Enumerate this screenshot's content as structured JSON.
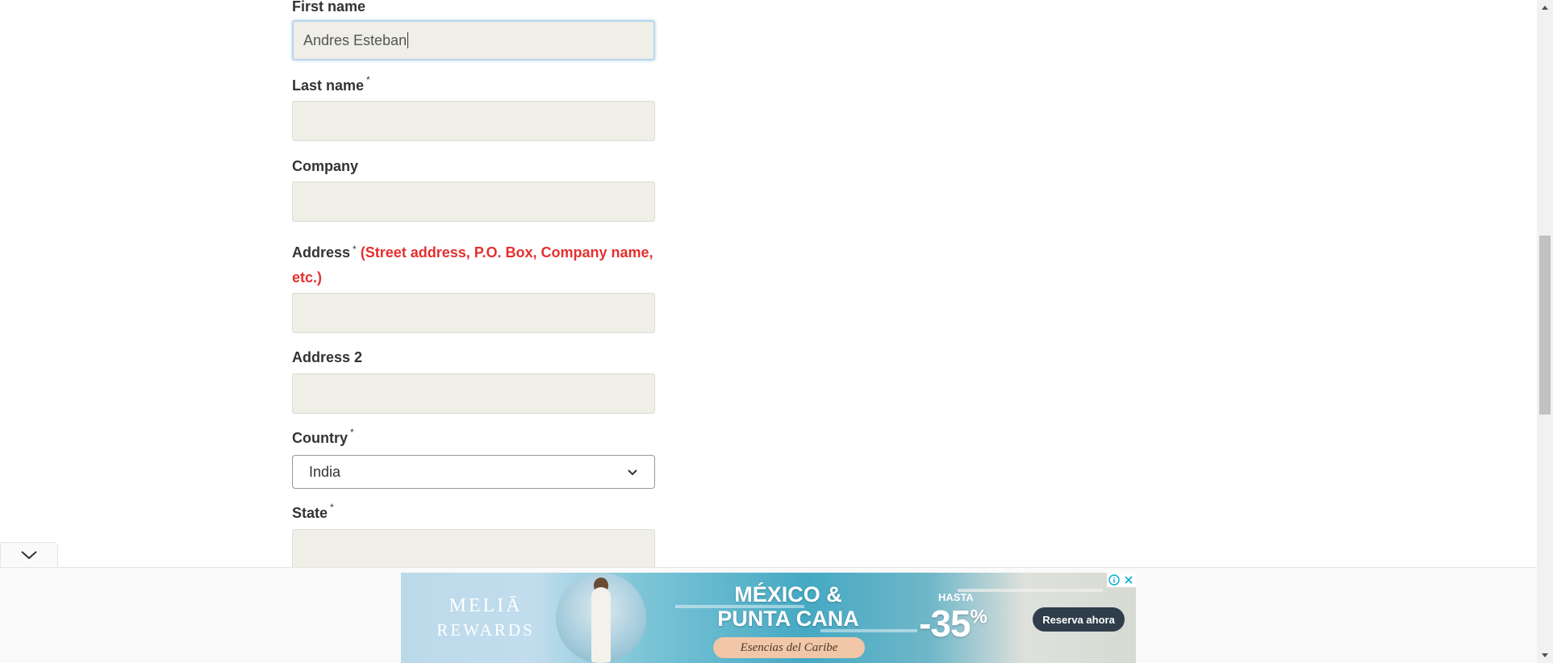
{
  "form": {
    "first_name": {
      "label": "First name",
      "value": "Andres Esteban"
    },
    "last_name": {
      "label": "Last name",
      "required_mark": "*",
      "value": ""
    },
    "company": {
      "label": "Company",
      "value": ""
    },
    "address": {
      "label": "Address",
      "required_mark": "*",
      "hint_line1": "(Street address, P.O. Box, Company name,",
      "hint_line2": "etc.)",
      "value": ""
    },
    "address2": {
      "label": "Address 2",
      "value": ""
    },
    "country": {
      "label": "Country",
      "required_mark": "*",
      "selected": "India"
    },
    "state": {
      "label": "State",
      "required_mark": "*",
      "value": ""
    }
  },
  "ad": {
    "brand_line1": "MELIĀ",
    "brand_line2": "REWARDS",
    "title_line1": "MÉXICO &",
    "title_line2": "PUNTA CANA",
    "tagline": "Esencias del Caribe",
    "hasta": "HASTA",
    "discount": "-35",
    "discount_unit": "%",
    "cta": "Reserva ahora"
  },
  "colors": {
    "hint": "#e4312f",
    "input_bg": "#efeee7",
    "focus_ring": "#b9d6ee"
  }
}
